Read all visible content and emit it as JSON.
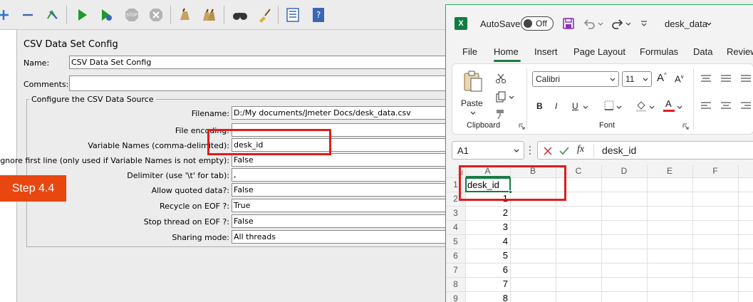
{
  "jmeter": {
    "panel_title": "CSV Data Set Config",
    "name_label": "Name:",
    "name_value": "CSV Data Set Config",
    "comments_label": "Comments:",
    "comments_value": "",
    "group_title": "Configure the CSV Data Source",
    "fields": [
      {
        "label": "Filename:",
        "value": "D:/My documents/Jmeter Docs/desk_data.csv"
      },
      {
        "label": "File encoding:",
        "value": ""
      },
      {
        "label": "Variable Names (comma-delimited):",
        "value": "desk_id"
      },
      {
        "label": "Ignore first line (only used if Variable Names is not empty):",
        "value": "False"
      },
      {
        "label": "Delimiter (use '\\t' for tab):",
        "value": ","
      },
      {
        "label": "Allow quoted data?:",
        "value": "False"
      },
      {
        "label": "Recycle on EOF ?:",
        "value": "True"
      },
      {
        "label": "Stop thread on EOF ?:",
        "value": "False"
      },
      {
        "label": "Sharing mode:",
        "value": "All threads"
      }
    ],
    "toolbar_icons": [
      "add-icon",
      "remove-icon",
      "toggle-icon",
      "start-icon",
      "start-no-pauses-icon",
      "stop-icon",
      "shutdown-icon",
      "clear-icon",
      "clear-all-icon",
      "search-icon",
      "reset-search-icon",
      "function-helper-icon",
      "help-icon"
    ]
  },
  "step_badge": "Step 4.4",
  "excel": {
    "autosave_label": "AutoSave",
    "autosave_state": "Off",
    "file_name": "desk_data",
    "tabs": [
      "File",
      "Home",
      "Insert",
      "Page Layout",
      "Formulas",
      "Data",
      "Review"
    ],
    "active_tab": "Home",
    "ribbon": {
      "paste_label": "Paste",
      "clipboard_label": "Clipboard",
      "font_name": "Calibri",
      "font_size": "11",
      "font_group_label": "Font",
      "bold": "B",
      "italic": "I",
      "underline": "U",
      "grow_font": "A",
      "shrink_font": "A",
      "font_color_letter": "A"
    },
    "name_box": "A1",
    "formula_value": "desk_id",
    "fx_label": "fx",
    "columns": [
      "A",
      "B",
      "C",
      "D",
      "E",
      "F"
    ],
    "rows": [
      "1",
      "2",
      "3",
      "4",
      "5",
      "6",
      "7",
      "8",
      "9"
    ],
    "cells_a": [
      "desk_id",
      "1",
      "2",
      "3",
      "4",
      "5",
      "6",
      "7",
      "8"
    ],
    "accent_color": "#107c41",
    "highlight_color": "#e01c1c"
  }
}
